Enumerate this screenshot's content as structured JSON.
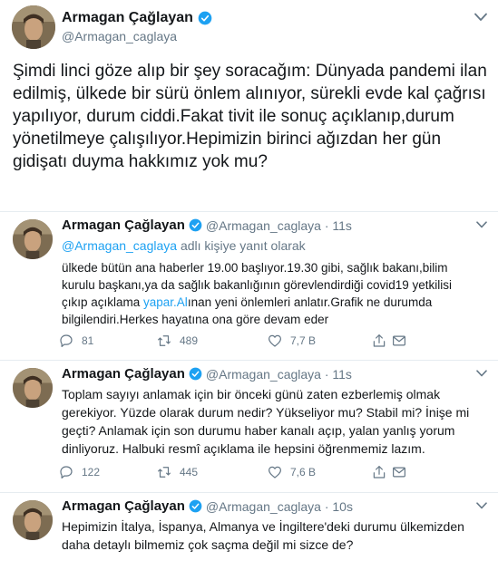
{
  "main_tweet": {
    "name": "Armagan Çağlayan",
    "handle": "@Armagan_caglaya",
    "text": "Şimdi linci göze alıp bir şey soracağım: Dünyada pandemi ilan edilmiş, ülkede bir sürü önlem alınıyor, sürekli evde kal çağrısı yapılıyor, durum ciddi.Fakat tivit ile sonuç açıklanıp,durum yönetilmeye çalışılıyor.Hepimizin birinci ağızdan her gün gidişatı duyma hakkımız yok mu?"
  },
  "replies": [
    {
      "name": "Armagan Çağlayan",
      "meta": "@Armagan_caglaya · 11s",
      "reply_prefix": "@Armagan_caglaya",
      "reply_suffix": " adlı kişiye yanıt olarak",
      "text_before_link": "ülkede bütün ana haberler 19.00 başlıyor.19.30 gibi, sağlık bakanı,bilim kurulu başkanı,ya da sağlık bakanlığının görevlendirdiği covid19 yetkilisi çıkıp açıklama ",
      "link": "yapar.Al",
      "text_after_link": "ınan yeni önlemleri anlatır.Grafik ne durumda bilgilendiri.Herkes hayatına ona göre devam eder",
      "replies_count": "81",
      "retweets_count": "489",
      "likes_count": "7,7 B"
    },
    {
      "name": "Armagan Çağlayan",
      "meta": "@Armagan_caglaya · 11s",
      "text": "Toplam sayıyı anlamak için bir önceki günü zaten ezberlemiş olmak gerekiyor. Yüzde olarak durum nedir? Yükseliyor mu? Stabil mi? İnişe mi geçti? Anlamak için son durumu haber kanalı açıp, yalan yanlış yorum dinliyoruz. Halbuki resmî açıklama ile hepsini öğrenmemiz lazım.",
      "replies_count": "122",
      "retweets_count": "445",
      "likes_count": "7,6 B"
    },
    {
      "name": "Armagan Çağlayan",
      "meta": "@Armagan_caglaya · 10s",
      "text": "Hepimizin İtalya, İspanya, Almanya ve İngiltere'deki durumu ülkemizden daha detaylı bilmemiz çok saçma değil mi sizce de?"
    }
  ],
  "icons": {
    "verified": "verified-badge-icon",
    "caret": "chevron-down-icon",
    "reply": "reply-icon",
    "retweet": "retweet-icon",
    "like": "heart-icon",
    "share": "share-icon",
    "mail": "mail-icon"
  },
  "colors": {
    "accent": "#1da1f2",
    "text": "#14171a",
    "muted": "#657786",
    "divider": "#e6ecf0"
  }
}
